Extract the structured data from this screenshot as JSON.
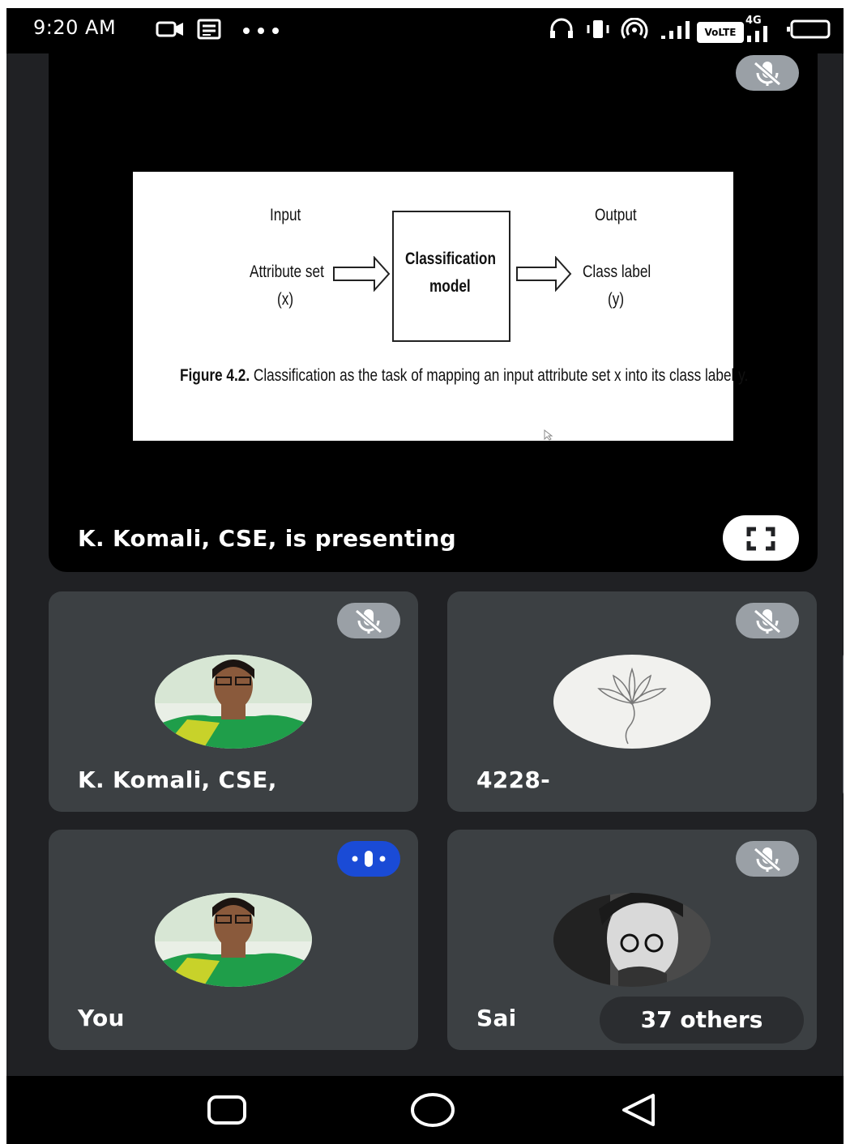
{
  "status_bar": {
    "time": "9:20 AM",
    "icons": [
      "video-camera-icon",
      "news-icon",
      "more-dots-icon",
      "headset-icon",
      "vibrate-icon",
      "hotspot-icon",
      "signal-icon",
      "volte-icon",
      "4g-signal-icon",
      "battery-icon"
    ],
    "volte_label": "VoLTE",
    "network_label": "4G"
  },
  "presentation": {
    "presenting_label": "K. Komali, CSE, is presenting",
    "slide": {
      "input_heading": "Input",
      "input_label": "Attribute set",
      "input_symbol": "(x)",
      "model_line1": "Classification",
      "model_line2": "model",
      "output_heading": "Output",
      "output_label": "Class label",
      "output_symbol": "(y)",
      "caption_bold": "Figure 4.2.",
      "caption_text": "Classification as the task of mapping an input attribute set x into its class label y."
    }
  },
  "participants": [
    {
      "name": "K. Komali, CSE,",
      "status": "muted",
      "avatar": "woman-green-saree-photo"
    },
    {
      "name": "4228-",
      "status": "muted",
      "avatar": "lotus-drawing"
    },
    {
      "name": "You",
      "status": "speaking",
      "avatar": "woman-green-saree-photo"
    },
    {
      "name": "Sai",
      "status": "muted",
      "avatar": "bw-portrait-glasses"
    }
  ],
  "others_label": "37 others",
  "colors": {
    "background": "#202124",
    "tile": "#3c4043",
    "mute_pill": "#9aa0a6",
    "speaking_pill": "#1a4bd6",
    "avatar_green": "#1f9e4a"
  }
}
